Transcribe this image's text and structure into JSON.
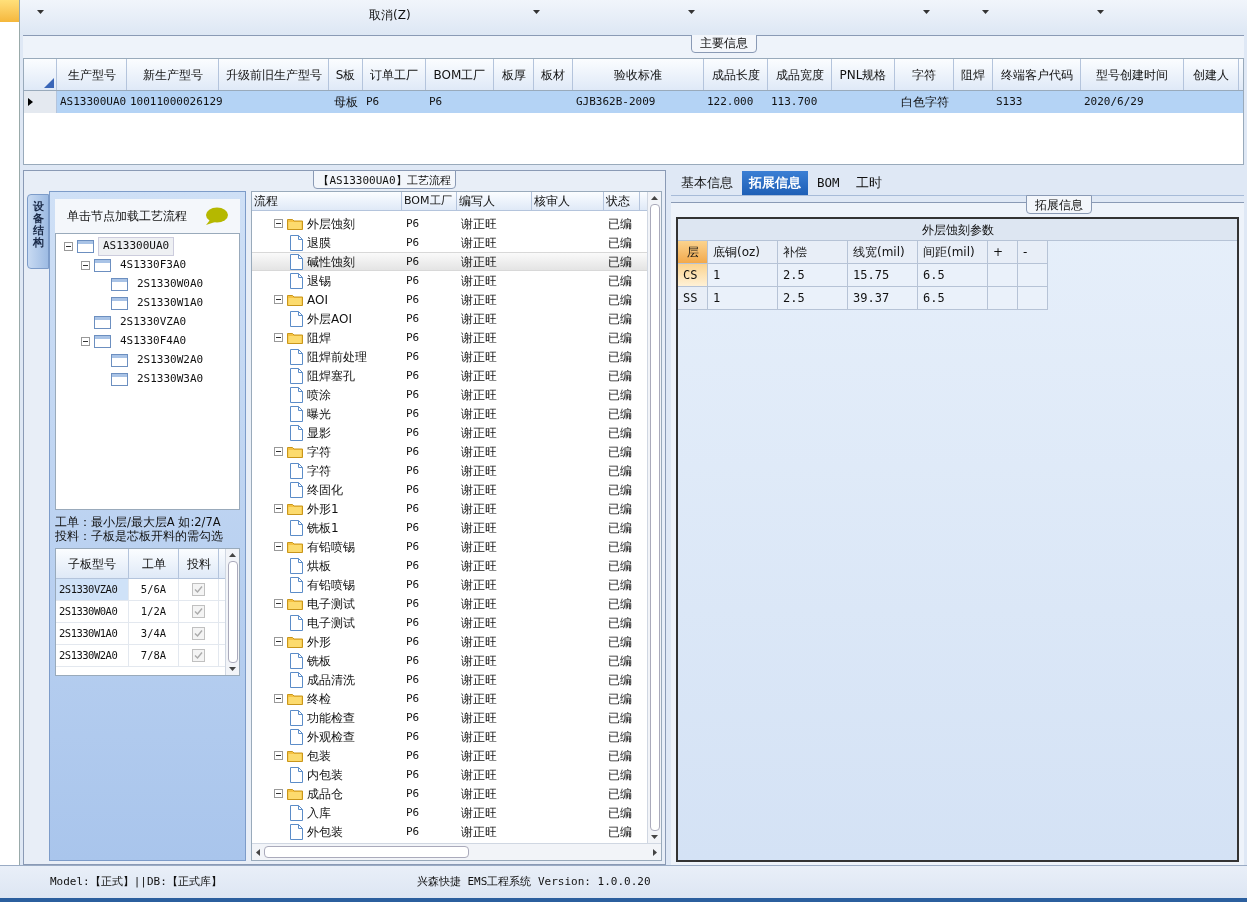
{
  "toolbar": {
    "items": [
      {
        "label": "取消(Z)"
      }
    ]
  },
  "main_info": {
    "title": "主要信息",
    "columns": [
      "生产型号",
      "新生产型号",
      "升级前旧生产型号",
      "S板",
      "订单工厂",
      "BOM工厂",
      "板厚",
      "板材",
      "验收标准",
      "成品长度",
      "成品宽度",
      "PNL规格",
      "字符",
      "阻焊",
      "终端客户代码",
      "型号创建时间",
      "创建人"
    ],
    "rows": [
      {
        "selected": true,
        "cells": [
          "AS13300UA0",
          "10011000026129",
          "",
          "母板",
          "P6",
          "P6",
          "",
          "",
          "GJB362B-2009",
          "122.000",
          "113.700",
          "",
          "白色字符",
          "",
          "S133",
          "2020/6/29",
          ""
        ]
      }
    ]
  },
  "left_panel": {
    "side_tab": "设备结构",
    "header": "单击节点加载工艺流程",
    "tree": [
      {
        "label": "AS13300UA0",
        "selected": true,
        "expanded": true,
        "children": [
          {
            "label": "4S1330F3A0",
            "selected": false,
            "expanded": true,
            "children": [
              {
                "label": "2S1330W0A0",
                "selected": false
              },
              {
                "label": "2S1330W1A0",
                "selected": false
              }
            ]
          },
          {
            "label": "2S1330VZA0",
            "selected": false
          },
          {
            "label": "4S1330F4A0",
            "selected": false,
            "expanded": true,
            "children": [
              {
                "label": "2S1330W2A0",
                "selected": false
              },
              {
                "label": "2S1330W3A0",
                "selected": false
              }
            ]
          }
        ]
      }
    ],
    "notes": [
      "工单：最小层/最大层A 如:2/7A",
      "投料：子板是芯板开料的需勾选"
    ],
    "boards": {
      "columns": [
        "子板型号",
        "工单",
        "投料"
      ],
      "rows": [
        {
          "name": "2S1330VZA0",
          "order": "5/6A",
          "feed": true,
          "selected": true
        },
        {
          "name": "2S1330W0A0",
          "order": "1/2A",
          "feed": true,
          "selected": false
        },
        {
          "name": "2S1330W1A0",
          "order": "3/4A",
          "feed": true,
          "selected": false
        },
        {
          "name": "2S1330W2A0",
          "order": "7/8A",
          "feed": true,
          "selected": false
        }
      ]
    }
  },
  "process": {
    "title": "【AS13300UA0】工艺流程",
    "columns": [
      "流程",
      "BOM工厂",
      "编写人",
      "核审人",
      "状态"
    ],
    "rows": [
      {
        "name": "外层蚀刻",
        "bom": "P6",
        "writer": "谢正旺",
        "status": "已编",
        "selected": false,
        "expanded": true,
        "children": [
          {
            "name": "退膜",
            "bom": "P6",
            "writer": "谢正旺",
            "status": "已编",
            "selected": false
          },
          {
            "name": "碱性蚀刻",
            "bom": "P6",
            "writer": "谢正旺",
            "status": "已编",
            "selected": true
          },
          {
            "name": "退锡",
            "bom": "P6",
            "writer": "谢正旺",
            "status": "已编",
            "selected": false
          }
        ]
      },
      {
        "name": "AOI",
        "bom": "P6",
        "writer": "谢正旺",
        "status": "已编",
        "selected": false,
        "expanded": true,
        "children": [
          {
            "name": "外层AOI",
            "bom": "P6",
            "writer": "谢正旺",
            "status": "已编",
            "selected": false
          }
        ]
      },
      {
        "name": "阻焊",
        "bom": "P6",
        "writer": "谢正旺",
        "status": "已编",
        "selected": false,
        "expanded": true,
        "children": [
          {
            "name": "阻焊前处理",
            "bom": "P6",
            "writer": "谢正旺",
            "status": "已编",
            "selected": false
          },
          {
            "name": "阻焊塞孔",
            "bom": "P6",
            "writer": "谢正旺",
            "status": "已编",
            "selected": false
          },
          {
            "name": "喷涂",
            "bom": "P6",
            "writer": "谢正旺",
            "status": "已编",
            "selected": false
          },
          {
            "name": "曝光",
            "bom": "P6",
            "writer": "谢正旺",
            "status": "已编",
            "selected": false
          },
          {
            "name": "显影",
            "bom": "P6",
            "writer": "谢正旺",
            "status": "已编",
            "selected": false
          }
        ]
      },
      {
        "name": "字符",
        "bom": "P6",
        "writer": "谢正旺",
        "status": "已编",
        "selected": false,
        "expanded": true,
        "children": [
          {
            "name": "字符",
            "bom": "P6",
            "writer": "谢正旺",
            "status": "已编",
            "selected": false
          },
          {
            "name": "终固化",
            "bom": "P6",
            "writer": "谢正旺",
            "status": "已编",
            "selected": false
          }
        ]
      },
      {
        "name": "外形1",
        "bom": "P6",
        "writer": "谢正旺",
        "status": "已编",
        "selected": false,
        "expanded": true,
        "children": [
          {
            "name": "铣板1",
            "bom": "P6",
            "writer": "谢正旺",
            "status": "已编",
            "selected": false
          }
        ]
      },
      {
        "name": "有铅喷锡",
        "bom": "P6",
        "writer": "谢正旺",
        "status": "已编",
        "selected": false,
        "expanded": true,
        "children": [
          {
            "name": "烘板",
            "bom": "P6",
            "writer": "谢正旺",
            "status": "已编",
            "selected": false
          },
          {
            "name": "有铅喷锡",
            "bom": "P6",
            "writer": "谢正旺",
            "status": "已编",
            "selected": false
          }
        ]
      },
      {
        "name": "电子测试",
        "bom": "P6",
        "writer": "谢正旺",
        "status": "已编",
        "selected": false,
        "expanded": true,
        "children": [
          {
            "name": "电子测试",
            "bom": "P6",
            "writer": "谢正旺",
            "status": "已编",
            "selected": false
          }
        ]
      },
      {
        "name": "外形",
        "bom": "P6",
        "writer": "谢正旺",
        "status": "已编",
        "selected": false,
        "expanded": true,
        "children": [
          {
            "name": "铣板",
            "bom": "P6",
            "writer": "谢正旺",
            "status": "已编",
            "selected": false
          },
          {
            "name": "成品清洗",
            "bom": "P6",
            "writer": "谢正旺",
            "status": "已编",
            "selected": false
          }
        ]
      },
      {
        "name": "终检",
        "bom": "P6",
        "writer": "谢正旺",
        "status": "已编",
        "selected": false,
        "expanded": true,
        "children": [
          {
            "name": "功能检查",
            "bom": "P6",
            "writer": "谢正旺",
            "status": "已编",
            "selected": false
          },
          {
            "name": "外观检查",
            "bom": "P6",
            "writer": "谢正旺",
            "status": "已编",
            "selected": false
          }
        ]
      },
      {
        "name": "包装",
        "bom": "P6",
        "writer": "谢正旺",
        "status": "已编",
        "selected": false,
        "expanded": true,
        "children": [
          {
            "name": "内包装",
            "bom": "P6",
            "writer": "谢正旺",
            "status": "已编",
            "selected": false
          }
        ]
      },
      {
        "name": "成品仓",
        "bom": "P6",
        "writer": "谢正旺",
        "status": "已编",
        "selected": false,
        "expanded": true,
        "children": [
          {
            "name": "入库",
            "bom": "P6",
            "writer": "谢正旺",
            "status": "已编",
            "selected": false
          },
          {
            "name": "外包装",
            "bom": "P6",
            "writer": "谢正旺",
            "status": "已编",
            "selected": false
          }
        ]
      }
    ]
  },
  "details": {
    "tabs": [
      {
        "label": "基本信息",
        "selected": false
      },
      {
        "label": "拓展信息",
        "selected": true
      },
      {
        "label": "BOM",
        "selected": false
      },
      {
        "label": "工时",
        "selected": false
      }
    ],
    "group_title": "拓展信息",
    "table": {
      "title": "外层蚀刻参数",
      "columns": [
        "层",
        "底铜(oz)",
        "补偿",
        "线宽(mil)",
        "间距(mil)",
        "+",
        "-"
      ],
      "rows": [
        {
          "selected": true,
          "cells": [
            "CS",
            "1",
            "2.5",
            "15.75",
            "6.5",
            "",
            ""
          ]
        },
        {
          "selected": false,
          "cells": [
            "SS",
            "1",
            "2.5",
            "39.37",
            "6.5",
            "",
            ""
          ]
        }
      ]
    }
  },
  "status_bar": {
    "left": "Model:【正式】||DB:【正式库】",
    "center": "兴森快捷 EMS工程系统 Version: 1.0.0.20"
  }
}
